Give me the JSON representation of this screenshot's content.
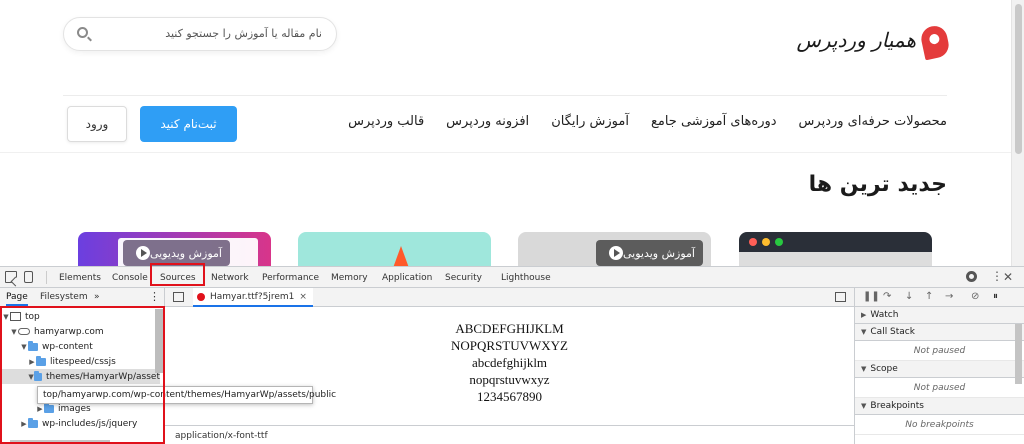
{
  "site": {
    "search_placeholder": "نام مقاله یا آموزش را جستجو کنید",
    "logo_text": "همیار وردپرس",
    "login_button": "ورود",
    "signup_button": "ثبت‌نام کنید",
    "nav_items": [
      "قالب وردپرس",
      "افزونه وردپرس",
      "آموزش رایگان",
      "دوره‌های آموزشی جامع",
      "محصولات حرفه‌ای وردپرس"
    ],
    "section_title": "جدید ترین ها",
    "cards": [
      {
        "chip": "آموزش ویدیویی"
      },
      {
        "chip": ""
      },
      {
        "chip": "آموزش ویدیویی"
      },
      {
        "chip": ""
      }
    ]
  },
  "devtools": {
    "tabs": [
      "Elements",
      "Console",
      "Sources",
      "Network",
      "Performance",
      "Memory",
      "Application",
      "Security",
      "Lighthouse"
    ],
    "active_tab": "Sources",
    "navigator": {
      "subtabs": [
        "Page",
        "Filesystem",
        "»"
      ],
      "tree": [
        {
          "label": "top",
          "type": "frame",
          "depth": 0,
          "open": true
        },
        {
          "label": "hamyarwp.com",
          "type": "cloud",
          "depth": 1,
          "open": true
        },
        {
          "label": "wp-content",
          "type": "folder",
          "depth": 2,
          "open": true
        },
        {
          "label": "litespeed/cssjs",
          "type": "folder",
          "depth": 3,
          "open": false
        },
        {
          "label": "themes/HamyarWp/asset",
          "type": "folder",
          "depth": 3,
          "open": true,
          "selected": true
        },
        {
          "label": "images",
          "type": "folder",
          "depth": 4,
          "open": false
        },
        {
          "label": "wp-includes/js/jquery",
          "type": "folder",
          "depth": 2,
          "open": false
        }
      ],
      "tooltip": "top/hamyarwp.com/wp-content/themes/HamyarWp/assets/public"
    },
    "editor": {
      "file_tab": "Hamyar.ttf?5jrem1",
      "preview_lines": [
        "ABCDEFGHIJKLM",
        "NOPQRSTUVWXYZ",
        "abcdefghijklm",
        "nopqrstuvwxyz",
        "1234567890"
      ],
      "status": "application/x-font-ttf"
    },
    "debugger": {
      "sections": [
        {
          "title": "Watch",
          "message": ""
        },
        {
          "title": "Call Stack",
          "message": "Not paused"
        },
        {
          "title": "Scope",
          "message": "Not paused"
        },
        {
          "title": "Breakpoints",
          "message": "No breakpoints"
        }
      ]
    },
    "colors": {
      "highlight_box": "#e0111b",
      "active_tab_underline": "#1a73e8"
    }
  }
}
